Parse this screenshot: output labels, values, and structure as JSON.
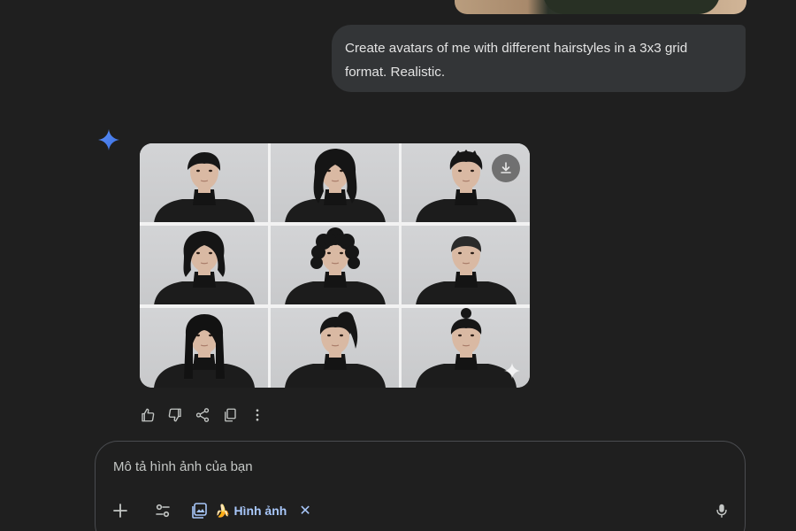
{
  "conversation": {
    "user_message": "Create avatars of me with different hairstyles in a 3x3 grid format. Realistic.",
    "response_image": {
      "grid": "3x3",
      "tiles": [
        {
          "hair": "short-textured"
        },
        {
          "hair": "long-wavy"
        },
        {
          "hair": "short-spiky"
        },
        {
          "hair": "shaggy-mullet"
        },
        {
          "hair": "curly"
        },
        {
          "hair": "buzz-cut"
        },
        {
          "hair": "long-straight"
        },
        {
          "hair": "high-ponytail"
        },
        {
          "hair": "top-knot"
        }
      ]
    }
  },
  "icons": {
    "assistant": "sparkle-icon",
    "download": "download-icon",
    "watermark": "sparkle-icon",
    "actions": [
      "thumbs-up-icon",
      "thumbs-down-icon",
      "share-icon",
      "copy-icon",
      "more-vert-icon"
    ]
  },
  "composer": {
    "placeholder": "Mô tả hình ảnh của bạn",
    "chip_label": "Hình ảnh",
    "chip_emoji": "🍌"
  },
  "colors": {
    "background": "#1f1f1f",
    "bubble": "#333537",
    "accent": "#a8c7fa",
    "spark_blue": "#4285f4"
  }
}
